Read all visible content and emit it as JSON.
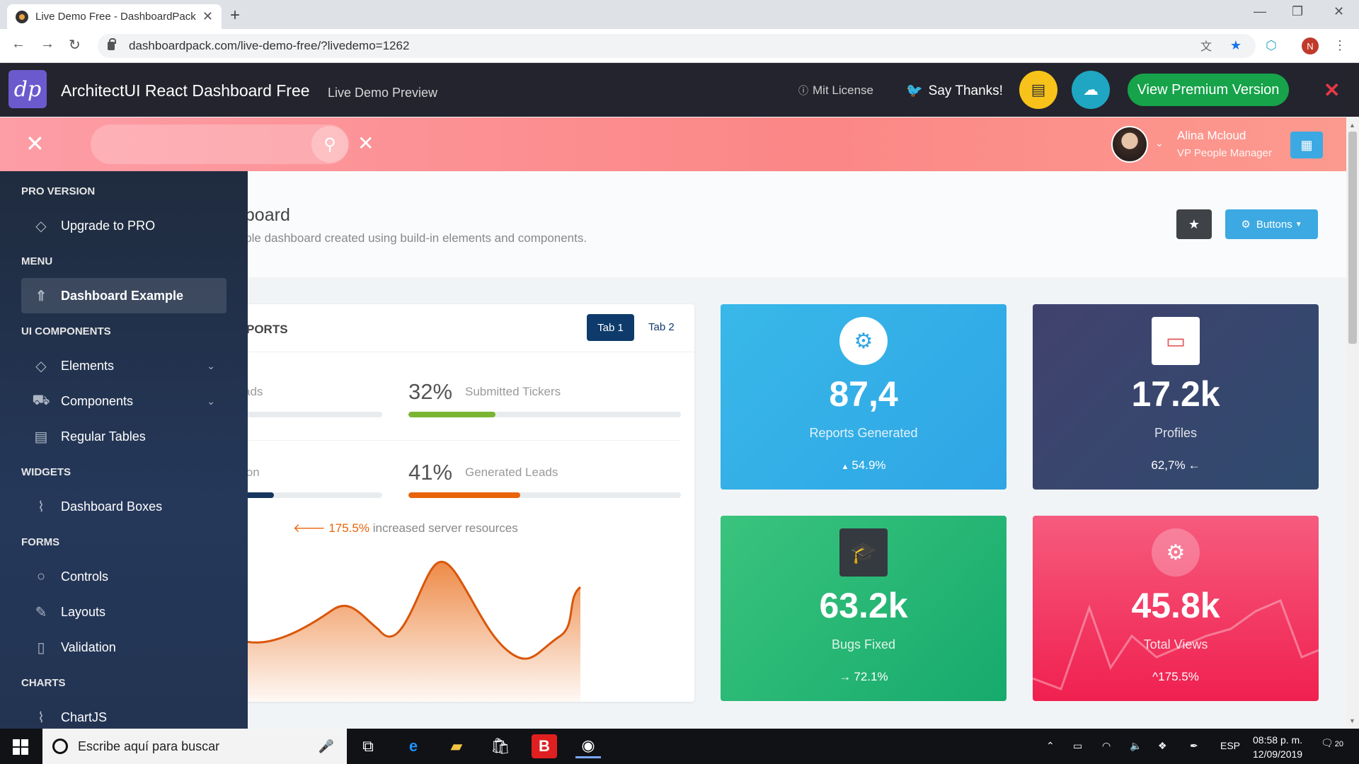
{
  "browser": {
    "tab_title": "Live Demo Free - DashboardPack",
    "url": "dashboardpack.com/live-demo-free/?livedemo=1262",
    "profile_initial": "N"
  },
  "dpbar": {
    "logo": "dp",
    "title": "ArchitectUI React Dashboard Free",
    "subtitle": "Live Demo Preview",
    "license": "Mit License",
    "thanks": "Say Thanks!",
    "premium": "View Premium Version"
  },
  "header": {
    "user_name": "Alina Mcloud",
    "user_role": "VP People Manager"
  },
  "page": {
    "title": "Analytics Dashboard",
    "title_visible": "hboard",
    "subtitle_visible": "mple dashboard created using build-in elements and components.",
    "buttons_label": "Buttons"
  },
  "sidebar": {
    "sections": [
      {
        "title": "PRO VERSION",
        "items": [
          {
            "label": "Upgrade to PRO",
            "icon": "diamond-icon"
          }
        ]
      },
      {
        "title": "MENU",
        "items": [
          {
            "label": "Dashboard Example",
            "icon": "rocket-icon",
            "active": true
          }
        ]
      },
      {
        "title": "UI COMPONENTS",
        "items": [
          {
            "label": "Elements",
            "icon": "diamond-icon"
          },
          {
            "label": "Components",
            "icon": "car-icon"
          },
          {
            "label": "Regular Tables",
            "icon": "table-icon"
          }
        ]
      },
      {
        "title": "WIDGETS",
        "items": [
          {
            "label": "Dashboard Boxes",
            "icon": "graph-icon"
          }
        ]
      },
      {
        "title": "FORMS",
        "items": [
          {
            "label": "Controls",
            "icon": "bulb-icon"
          },
          {
            "label": "Layouts",
            "icon": "pencil-icon"
          },
          {
            "label": "Validation",
            "icon": "battery-icon"
          }
        ]
      },
      {
        "title": "CHARTS",
        "items": [
          {
            "label": "ChartJS",
            "icon": "graph-icon"
          }
        ]
      }
    ]
  },
  "reports": {
    "title_visible": "PORTS",
    "tab1": "Tab 1",
    "tab2": "Tab 2",
    "rows": [
      {
        "label_visible": "ads",
        "color": "#d92550",
        "fill": 0.22
      },
      {
        "pct": "32%",
        "label": "Submitted Tickers",
        "color": "#7ab532",
        "fill": 0.32
      },
      {
        "label_visible": "ion",
        "color": "#16365f",
        "fill": 0.41
      },
      {
        "pct": "41%",
        "label": "Generated Leads",
        "color": "#e8630a",
        "fill": 0.41
      }
    ],
    "server_pct": "175.5%",
    "server_text": " increased server resources"
  },
  "tiles": [
    {
      "value": "87,4",
      "label": "Reports Generated",
      "change": "54.9%",
      "arrow": "▲",
      "icon": "gear-icon"
    },
    {
      "value": "17.2k",
      "label": "Profiles",
      "change": "62,7%",
      "arrow": "←",
      "icon": "monitor-icon"
    },
    {
      "value": "63.2k",
      "label": "Bugs Fixed",
      "change": "72.1%",
      "arrow": "→",
      "icon": "graduation-cap-icon"
    },
    {
      "value": "45.8k",
      "label": "Total Views",
      "change": "175.5%",
      "arrow": "^",
      "icon": "gear-icon"
    }
  ],
  "taskbar": {
    "search_placeholder": "Escribe aquí para buscar",
    "lang": "ESP",
    "time": "08:58 p. m.",
    "date": "12/09/2019",
    "notif": "20"
  }
}
